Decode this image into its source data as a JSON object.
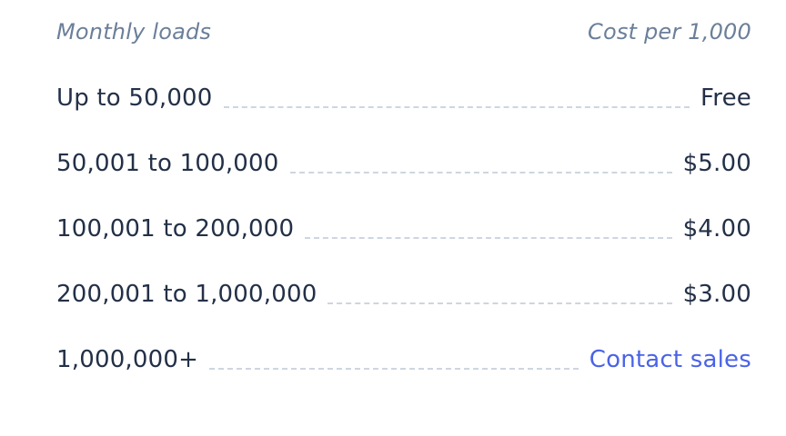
{
  "table": {
    "headers": {
      "loads": "Monthly loads",
      "cost": "Cost per 1,000"
    },
    "tiers": [
      {
        "range": "Up to 50,000",
        "price": "Free"
      },
      {
        "range": "50,001 to 100,000",
        "price": "$5.00"
      },
      {
        "range": "100,001 to 200,000",
        "price": "$4.00"
      },
      {
        "range": "200,001 to 1,000,000",
        "price": "$3.00"
      },
      {
        "range": "1,000,000+",
        "price": "Contact sales"
      }
    ]
  },
  "colors": {
    "header_text": "#6b7f99",
    "body_text": "#233047",
    "leader": "#cdd6e0",
    "link": "#4a63e7"
  }
}
